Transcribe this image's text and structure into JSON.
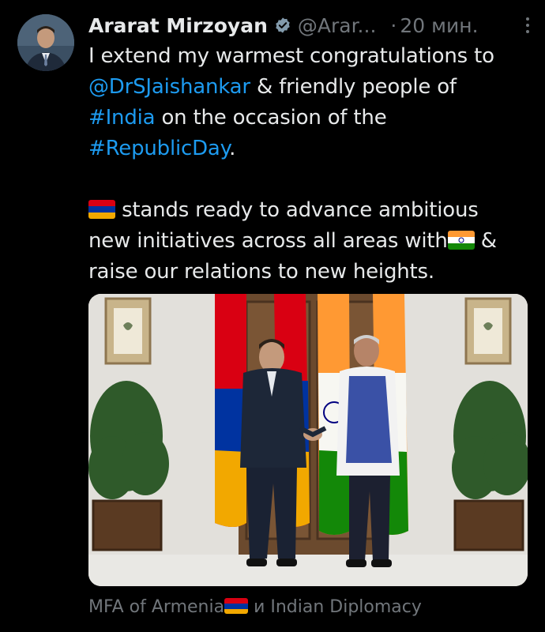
{
  "author": {
    "name": "Ararat Mirzoyan",
    "handle": "@Arar...",
    "separator": "·",
    "time": "20 мин.",
    "verified_icon": "verified-badge-icon"
  },
  "tweet": {
    "line1": "I extend my warmest congratulations to",
    "mention": "@DrSJaishankar",
    "line2_rest": " & friendly people of",
    "hashtag_india": "#India",
    "line3_rest": " on the occasion of the",
    "hashtag_republic": "#RepublicDay",
    "period": ".",
    "para2_line1": " stands ready to advance ambitious",
    "para2_line2": "new initiatives across all areas with",
    "para2_line2_end": " &",
    "para2_line3": "raise our relations to new heights."
  },
  "caption": {
    "before": "MFA of Armenia",
    "after": " и Indian Diplomacy"
  },
  "colors": {
    "background": "#000000",
    "text": "#e7e9ea",
    "muted": "#71767b",
    "link": "#1d9bf0",
    "verified": "#829aab"
  }
}
